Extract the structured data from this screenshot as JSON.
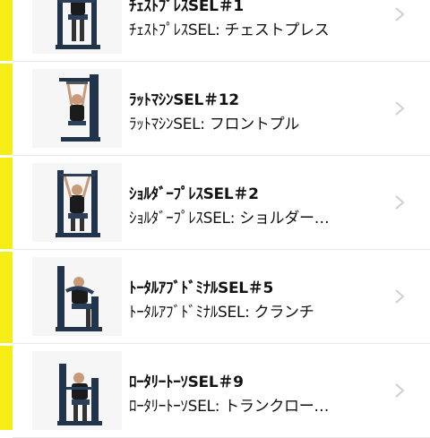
{
  "colors": {
    "accent": "#f5ee16",
    "text": "#111111",
    "chevron": "#cfcfcf",
    "machine": "#22344c"
  },
  "list": {
    "items": [
      {
        "title": "ﾁｪｽﾄﾌﾟﾚｽSEL＃1",
        "subtitle": "ﾁｪｽﾄﾌﾟﾚｽSEL: チェストプレス",
        "icon": "chest-press-machine"
      },
      {
        "title": "ﾗｯﾄﾏｼﾝSEL＃12",
        "subtitle": "ﾗｯﾄﾏｼﾝSEL: フロントプル",
        "icon": "lat-pulldown-machine"
      },
      {
        "title": "ｼｮﾙﾀﾞｰﾌﾟﾚｽSEL＃2",
        "subtitle": "ｼｮﾙﾀﾞｰﾌﾟﾚｽSEL: ショルダー…",
        "icon": "shoulder-press-machine"
      },
      {
        "title": "ﾄｰﾀﾙｱﾌﾞﾄﾞﾐﾅﾙSEL＃5",
        "subtitle": "ﾄｰﾀﾙｱﾌﾞﾄﾞﾐﾅﾙSEL: クランチ",
        "icon": "abdominal-machine"
      },
      {
        "title": "ﾛｰﾀﾘｰﾄｰｿSEL＃9",
        "subtitle": "ﾛｰﾀﾘｰﾄｰｿSEL: トランクロー…",
        "icon": "rotary-torso-machine"
      }
    ]
  }
}
